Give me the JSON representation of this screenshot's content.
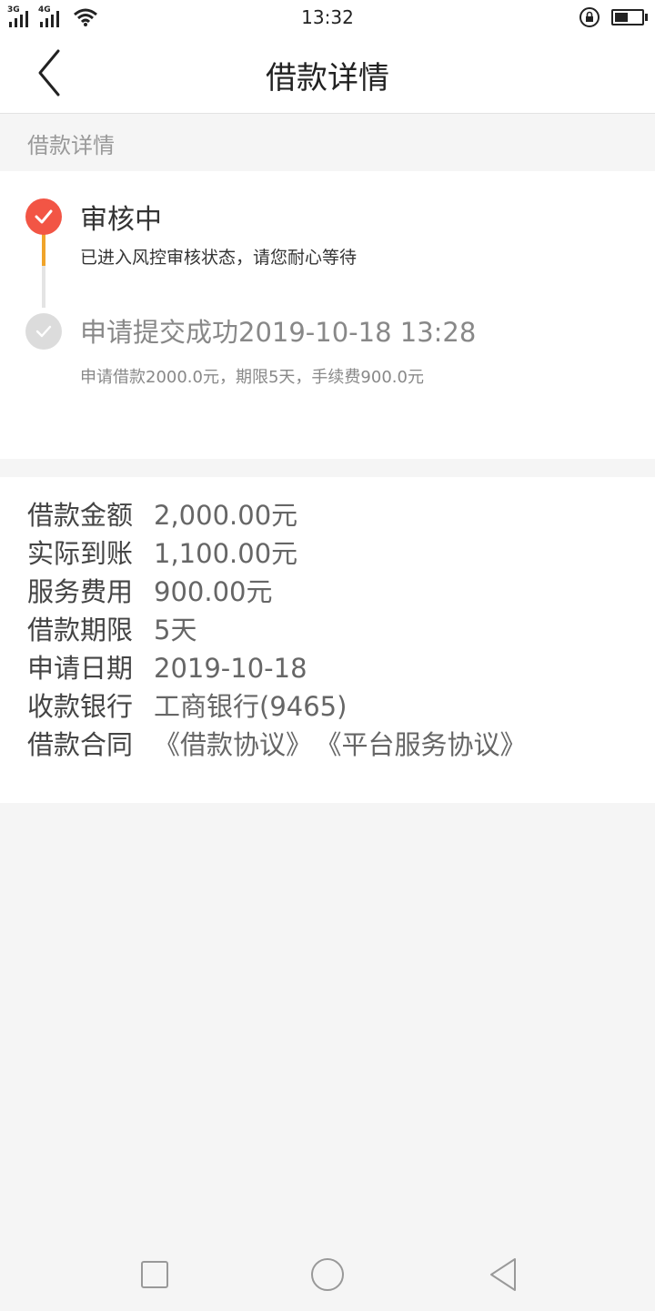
{
  "status_bar": {
    "network_1": "3G",
    "network_2": "4G",
    "time": "13:32",
    "battery_level": 0.5
  },
  "header": {
    "title": "借款详情",
    "back_icon": "chevron-left-icon"
  },
  "section_label": "借款详情",
  "timeline": {
    "steps": [
      {
        "title": "审核中",
        "desc": "已进入风控审核状态，请您耐心等待",
        "state": "active",
        "color": "#f25545"
      },
      {
        "title": "申请提交成功2019-10-18 13:28",
        "desc": "申请借款2000.0元，期限5天，手续费900.0元",
        "state": "done",
        "color": "#dcdcdc"
      }
    ],
    "active_line_color": "#f0a42a"
  },
  "loan_info": {
    "rows": [
      {
        "label": "借款金额",
        "value": "2,000.00元"
      },
      {
        "label": "实际到账",
        "value": "1,100.00元"
      },
      {
        "label": "服务费用",
        "value": "900.00元"
      },
      {
        "label": "借款期限",
        "value": "5天"
      },
      {
        "label": "申请日期",
        "value": "2019-10-18"
      },
      {
        "label": "收款银行",
        "value": "工商银行(9465)"
      }
    ],
    "contract": {
      "label": "借款合同",
      "links": [
        "《借款协议》",
        "《平台服务协议》"
      ]
    }
  },
  "nav_bar": {
    "recent_icon": "square-icon",
    "home_icon": "circle-icon",
    "back_icon": "triangle-back-icon"
  }
}
